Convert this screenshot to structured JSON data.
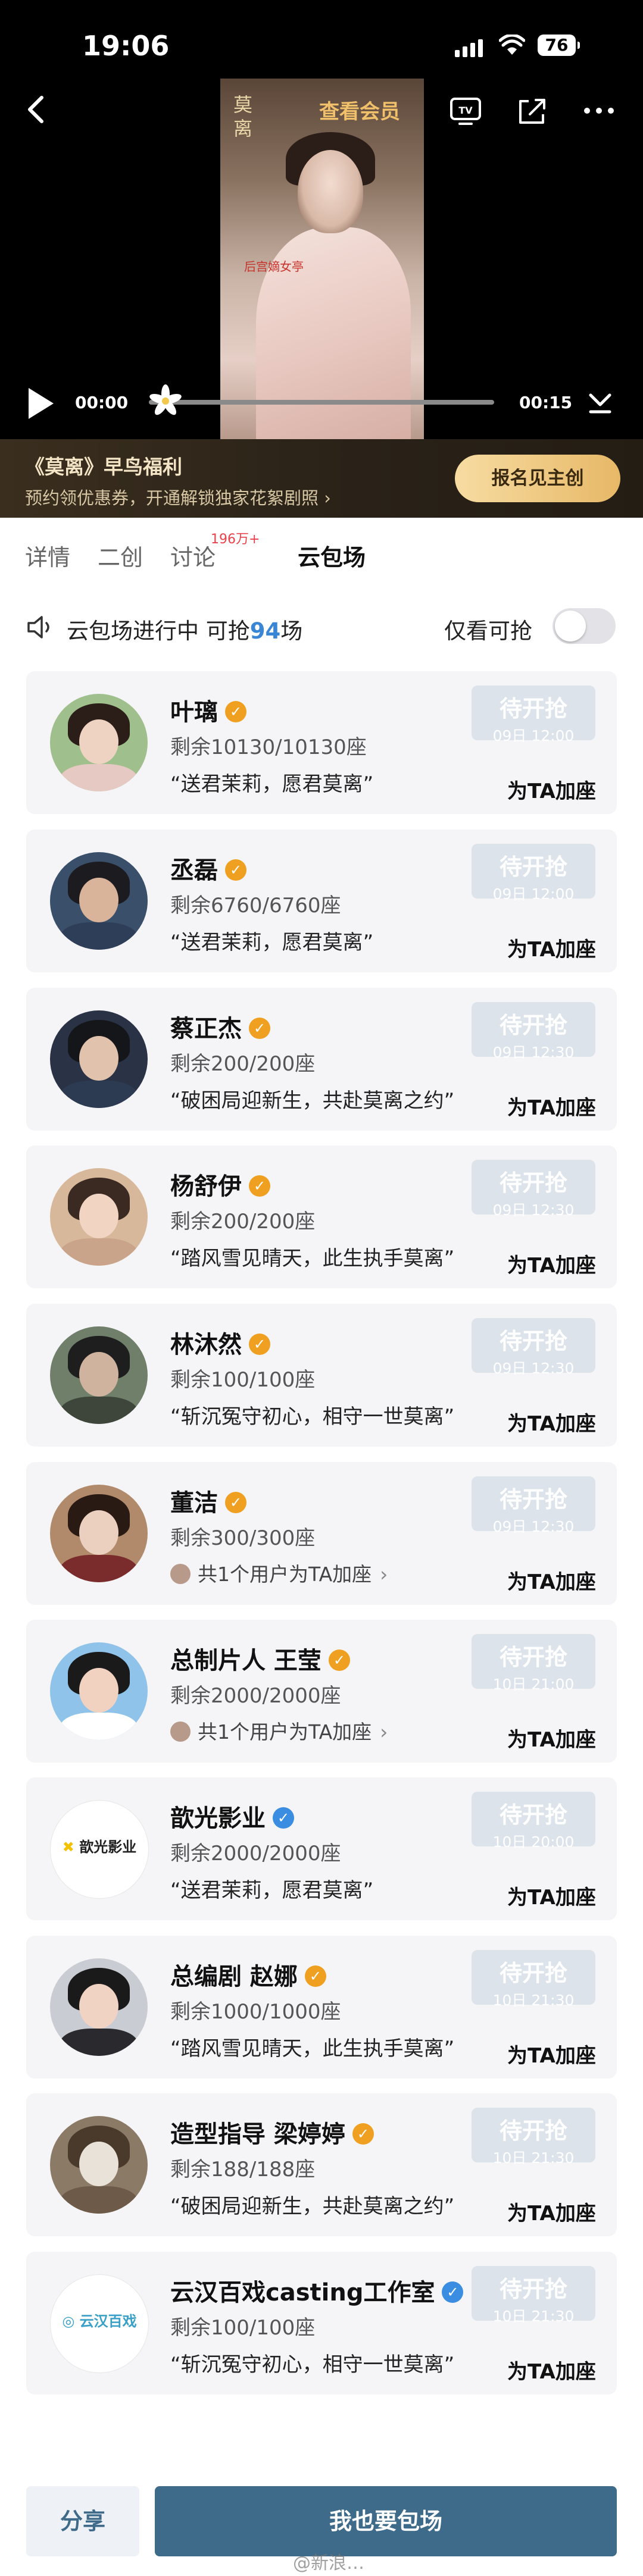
{
  "status_bar": {
    "time": "19:06",
    "battery": "76"
  },
  "video": {
    "member_button": "查看会员",
    "poster_title": "莫离",
    "poster_subtitle": "后宫嫡女亭",
    "current_time": "00:00",
    "total_time": "00:15",
    "progress": 0.0
  },
  "promo": {
    "title": "《莫离》早鸟福利",
    "subtitle": "预约领优惠券，开通解锁独家花絮剧照 ›",
    "button": "报名见主创"
  },
  "tabs": {
    "items": [
      "详情",
      "二创",
      "讨论",
      "云包场"
    ],
    "badge": "196万+",
    "active_index": 3
  },
  "status": {
    "prefix": "云包场进行中 可抢",
    "count": "94",
    "suffix": "场",
    "only_label": "仅看可抢",
    "toggle_on": false
  },
  "colors": {
    "verify_orange": "#f0a020",
    "verify_blue": "#3a8de0",
    "accent_blue": "#3f6b8b"
  },
  "cards": [
    {
      "name": "叶璃",
      "verify": "orange",
      "seats": "剩余10130/10130座",
      "slogan": "“送君茉莉，愿君莫离”",
      "wait": "待开抢",
      "wait_time": "09日 12:00",
      "add": "为TA加座",
      "avatar": {
        "bg": "#9fbf8c",
        "hair": "#2b1d17",
        "skin": "#efd3c2",
        "body": "#e6c9c2"
      }
    },
    {
      "name": "丞磊",
      "verify": "orange",
      "seats": "剩余6760/6760座",
      "slogan": "“送君茉莉，愿君莫离”",
      "wait": "待开抢",
      "wait_time": "09日 12:00",
      "add": "为TA加座",
      "avatar": {
        "bg": "#3a4f6a",
        "hair": "#1c1c20",
        "skin": "#d9b39a",
        "body": "#2e3e58"
      }
    },
    {
      "name": "蔡正杰",
      "verify": "orange",
      "seats": "剩余200/200座",
      "slogan": "“破困局迎新生，共赴莫离之约”",
      "wait": "待开抢",
      "wait_time": "09日 12:30",
      "add": "为TA加座",
      "avatar": {
        "bg": "#2a3346",
        "hair": "#15161a",
        "skin": "#e1c2ad",
        "body": "#2c3a52"
      }
    },
    {
      "name": "杨舒伊",
      "verify": "orange",
      "seats": "剩余200/200座",
      "slogan": "“踏风雪见晴天，此生执手莫离”",
      "wait": "待开抢",
      "wait_time": "09日 12:30",
      "add": "为TA加座",
      "avatar": {
        "bg": "#d8b89a",
        "hair": "#3b2a22",
        "skin": "#f1d4c2",
        "body": "#c9a48a"
      }
    },
    {
      "name": "林沐然",
      "verify": "orange",
      "seats": "剩余100/100座",
      "slogan": "“斩沉冤守初心，相守一世莫离”",
      "wait": "待开抢",
      "wait_time": "09日 12:30",
      "add": "为TA加座",
      "avatar": {
        "bg": "#6f7f6a",
        "hair": "#1e1e1e",
        "skin": "#cfb39f",
        "body": "#3e463c"
      }
    },
    {
      "name": "董洁",
      "verify": "orange",
      "seats": "剩余300/300座",
      "supporter": "共1个用户为TA加座",
      "wait": "待开抢",
      "wait_time": "09日 12:30",
      "add": "为TA加座",
      "avatar": {
        "bg": "#b08a6a",
        "hair": "#2a1a14",
        "skin": "#ecd0bf",
        "body": "#7a2b2b"
      }
    },
    {
      "name": "总制片人 王莹",
      "verify": "orange",
      "seats": "剩余2000/2000座",
      "supporter": "共1个用户为TA加座",
      "wait": "待开抢",
      "wait_time": "10日 21:00",
      "add": "为TA加座",
      "avatar": {
        "bg": "#8fc3ea",
        "hair": "#1a1a1a",
        "skin": "#f1d2c0",
        "body": "#ffffff"
      }
    },
    {
      "name": "歆光影业",
      "verify": "blue",
      "seats": "剩余2000/2000座",
      "slogan": "“送君茉莉，愿君莫离”",
      "wait": "待开抢",
      "wait_time": "10日 20:00",
      "add": "为TA加座",
      "logo_text": "歆光影业"
    },
    {
      "name": "总编剧 赵娜",
      "verify": "orange",
      "seats": "剩余1000/1000座",
      "slogan": "“踏风雪见晴天，此生执手莫离”",
      "wait": "待开抢",
      "wait_time": "10日 21:30",
      "add": "为TA加座",
      "avatar": {
        "bg": "#c9ccd2",
        "hair": "#1a1a1a",
        "skin": "#f0d3c2",
        "body": "#2a2a2e"
      }
    },
    {
      "name": "造型指导 梁婷婷",
      "verify": "orange",
      "seats": "剩余188/188座",
      "slogan": "“破困局迎新生，共赴莫离之约”",
      "wait": "待开抢",
      "wait_time": "10日 21:30",
      "add": "为TA加座",
      "avatar": {
        "bg": "#8a7a66",
        "hair": "#4a3a2c",
        "skin": "#e8e2d8",
        "body": "#6d5a48"
      }
    },
    {
      "name": "云汉百戏casting工作室",
      "verify": "blue",
      "seats": "剩余100/100座",
      "slogan": "“斩沉冤守初心，相守一世莫离”",
      "wait": "待开抢",
      "wait_time": "10日 21:30",
      "add": "为TA加座",
      "logo_text": "云汉百戏"
    }
  ],
  "bottom": {
    "share": "分享",
    "book": "我也要包场",
    "watermark": "@新浪…"
  }
}
